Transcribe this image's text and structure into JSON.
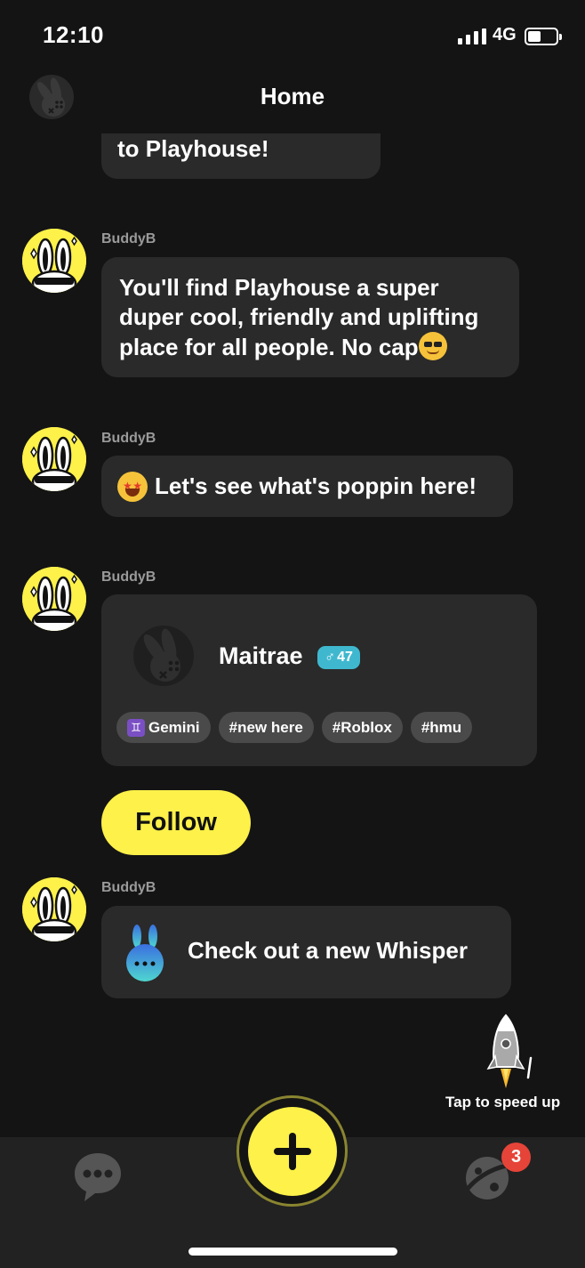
{
  "status_bar": {
    "time": "12:10",
    "network": "4G"
  },
  "header": {
    "title": "Home"
  },
  "chat": {
    "top_partial": "to Playhouse!",
    "messages": [
      {
        "sender": "BuddyB",
        "text": "You'll find Playhouse a super duper cool, friendly and uplifting place for all people. No cap"
      },
      {
        "sender": "BuddyB",
        "text": "Let's see what's poppin here!"
      },
      {
        "sender": "BuddyB"
      },
      {
        "sender": "BuddyB",
        "text": "Check out a new Whisper"
      }
    ],
    "profile_card": {
      "name": "Maitrae",
      "gender_symbol": "♂",
      "age": "47",
      "tags": [
        {
          "icon": "♊",
          "label": "Gemini"
        },
        {
          "label": "#new here"
        },
        {
          "label": "#Roblox"
        },
        {
          "label": "#hmu"
        }
      ]
    },
    "follow_label": "Follow"
  },
  "speed_up": {
    "label": "Tap to speed up"
  },
  "bottom_nav": {
    "notification_count": "3"
  },
  "colors": {
    "accent": "#fdf14a",
    "background": "#141414",
    "bubble": "#2a2a2a",
    "badge_red": "#e64438",
    "gender_badge": "#3fb8cf"
  }
}
